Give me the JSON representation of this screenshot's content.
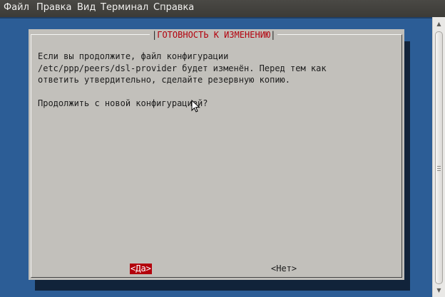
{
  "menubar": {
    "items": [
      "Файл",
      "Правка",
      "Вид",
      "Терминал",
      "Справка"
    ]
  },
  "dialog": {
    "title": "ГОТОВНОСТЬ К ИЗМЕНЕНИЮ",
    "message": "Если вы продолжите, файл конфигурации\n/etc/ppp/peers/dsl-provider будет изменён. Перед тем как\nответить утвердительно, сделайте резервную копию.\n\nПродолжить с новой конфигурацией?",
    "yes_button": "<Да>",
    "no_button": "<Нет>"
  },
  "colors": {
    "terminal_bg": "#2c5d96",
    "dialog_bg": "#c2c0bb",
    "accent_red": "#b3000c"
  },
  "icons": [
    "mouse-pointer-icon",
    "scroll-up-arrow-icon",
    "scroll-down-arrow-icon"
  ]
}
